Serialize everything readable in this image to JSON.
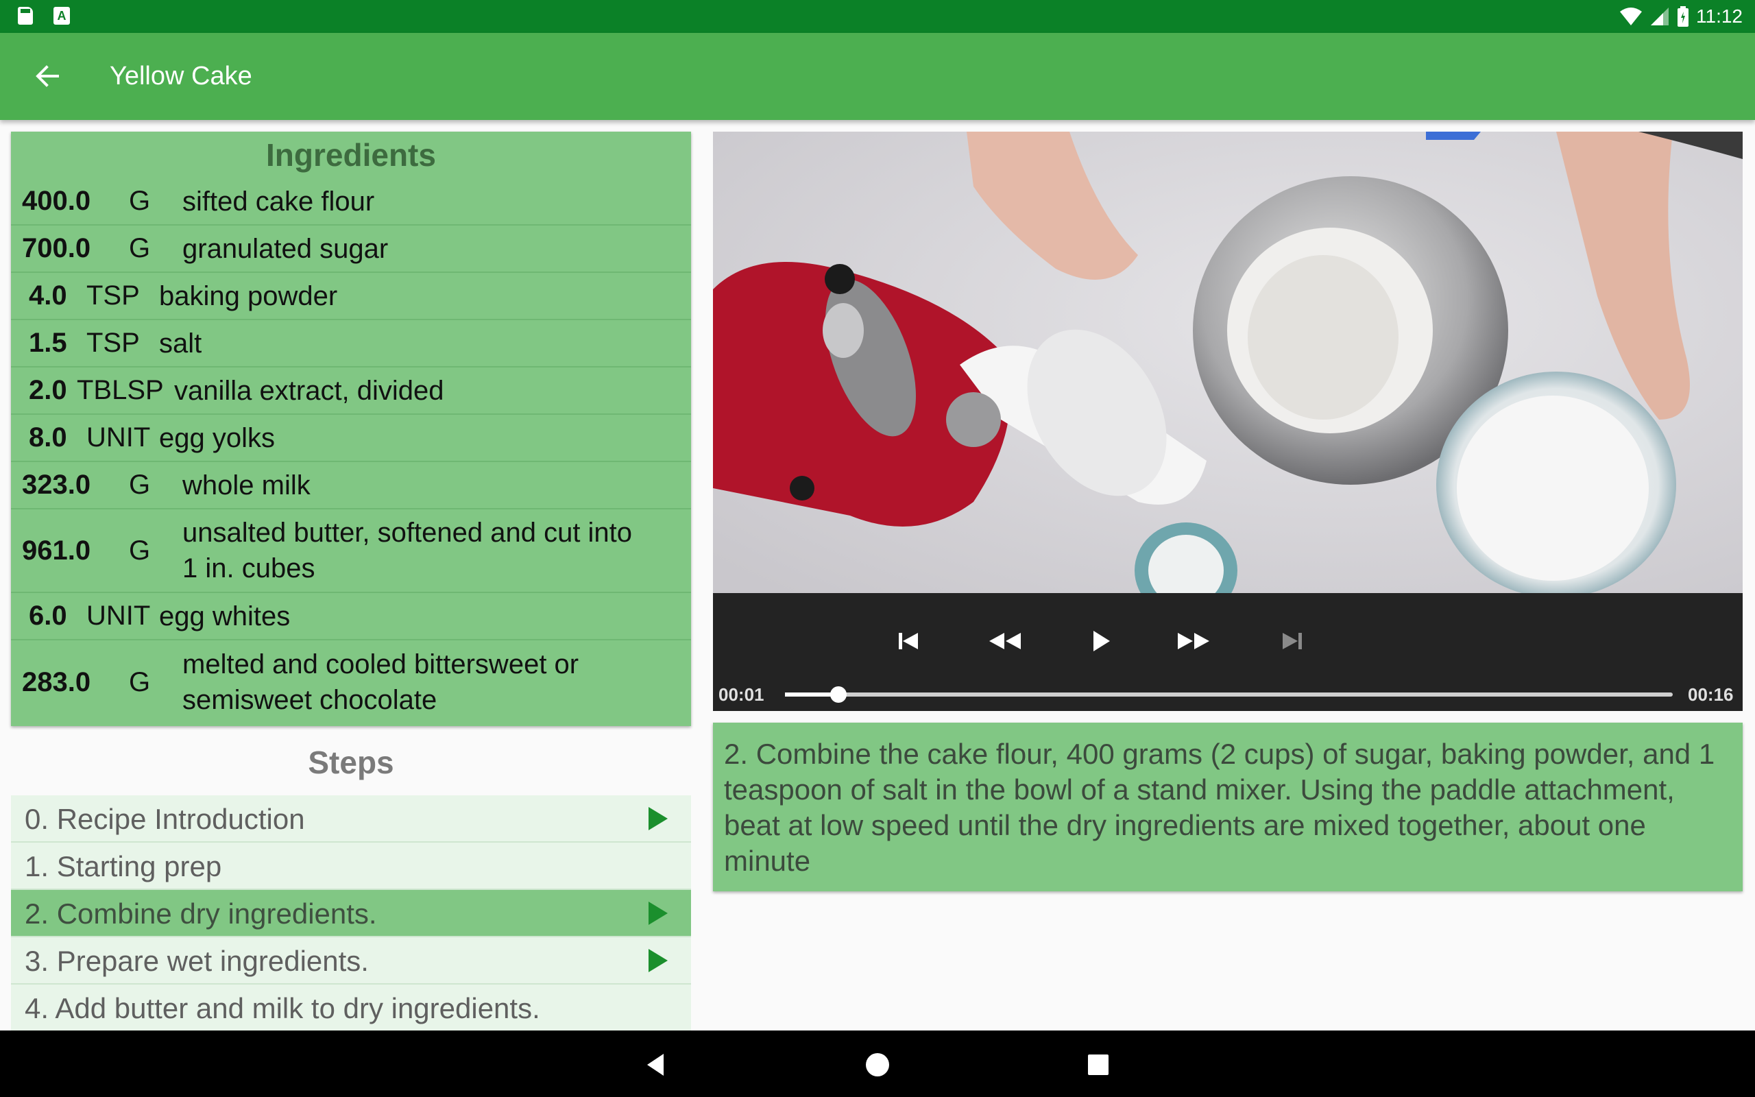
{
  "status_bar": {
    "time": "11:12",
    "icons": [
      "sd-card-icon",
      "a-notification-icon",
      "wifi-icon",
      "cell-signal-icon",
      "battery-icon"
    ]
  },
  "app_bar": {
    "title": "Yellow Cake",
    "back_icon": "arrow-back-icon"
  },
  "ingredients": {
    "heading": "Ingredients",
    "items": [
      {
        "qty": "400.0",
        "unit": "G",
        "name": "sifted cake flour"
      },
      {
        "qty": "700.0",
        "unit": "G",
        "name": "granulated sugar"
      },
      {
        "qty": "4.0",
        "unit": "TSP",
        "name": "baking powder"
      },
      {
        "qty": "1.5",
        "unit": "TSP",
        "name": "salt"
      },
      {
        "qty": "2.0",
        "unit": "TBLSP",
        "name": "vanilla extract, divided"
      },
      {
        "qty": "8.0",
        "unit": "UNIT",
        "name": "egg yolks"
      },
      {
        "qty": "323.0",
        "unit": "G",
        "name": "whole milk"
      },
      {
        "qty": "961.0",
        "unit": "G",
        "name": "unsalted butter, softened and cut into 1 in. cubes"
      },
      {
        "qty": "6.0",
        "unit": "UNIT",
        "name": "egg whites"
      },
      {
        "qty": "283.0",
        "unit": "G",
        "name": "melted and cooled bittersweet or semisweet chocolate"
      }
    ]
  },
  "steps": {
    "heading": "Steps",
    "items": [
      {
        "label": "0. Recipe Introduction",
        "has_video": true
      },
      {
        "label": "1. Starting prep",
        "has_video": false
      },
      {
        "label": "2. Combine dry ingredients.",
        "has_video": true
      },
      {
        "label": "3. Prepare wet ingredients.",
        "has_video": true
      },
      {
        "label": "4. Add butter and milk to dry ingredients.",
        "has_video": false
      }
    ],
    "selected_index": 2
  },
  "player": {
    "current_time": "00:01",
    "duration": "00:16",
    "progress_fraction": 0.06,
    "controls": [
      "skip-previous-icon",
      "rewind-icon",
      "play-icon",
      "fast-forward-icon",
      "skip-next-icon"
    ]
  },
  "step_description": "2. Combine the cake flour, 400 grams (2 cups) of sugar, baking powder, and 1 teaspoon of salt in the bowl of a stand mixer. Using the paddle attachment, beat at low speed until the dry ingredients are mixed together, about one minute",
  "colors": {
    "status_bar": "#0b8127",
    "app_bar": "#4caf50",
    "card": "#81c784",
    "step_row": "#e8f5e9",
    "accent_play": "#1b8f2d"
  },
  "nav_bar": {
    "buttons": [
      "back-triangle-icon",
      "home-circle-icon",
      "recents-square-icon"
    ]
  }
}
